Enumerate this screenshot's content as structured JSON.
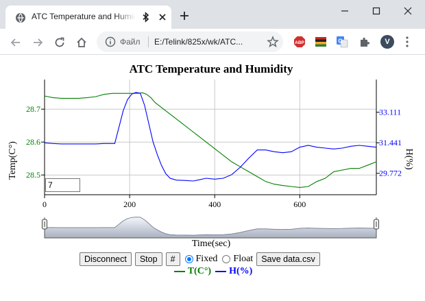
{
  "browser": {
    "tab_title": "ATC Temperature and Humidity",
    "omnibox_label": "Файл",
    "url": "E:/Telink/825x/wk/ATC...",
    "profile_initial": "V"
  },
  "page": {
    "title": "ATC Temperature and Humidity",
    "roll_value": "7",
    "x_axis_label": "Time(sec)",
    "buttons": {
      "disconnect": "Disconnect",
      "stop": "Stop",
      "grid": "#",
      "save": "Save data.csv"
    },
    "radios": {
      "fixed": "Fixed",
      "float": "Float",
      "selected": "Fixed"
    },
    "legend": {
      "temp": "T(C°)",
      "hum": "H(%)"
    }
  },
  "chart_data": {
    "type": "line",
    "title": "ATC Temperature and Humidity",
    "xlabel": "Time(sec)",
    "ylabel": "Temp(C°)",
    "ylabel_right": "H(%)",
    "xlim": [
      0,
      780
    ],
    "x_ticks": [
      "0",
      "200",
      "400",
      "600"
    ],
    "y_left": {
      "lim": [
        28.44,
        28.79
      ],
      "ticks": [
        "28.5",
        "28.6",
        "28.7"
      ]
    },
    "y_right": {
      "lim": [
        28.6,
        34.9
      ],
      "ticks": [
        "29.772",
        "31.441",
        "33.111"
      ]
    },
    "grid": true,
    "legend_position": "bottom-center",
    "series": [
      {
        "name": "T(C°)",
        "color": "#008000",
        "axis": "left",
        "points": [
          [
            0,
            28.74
          ],
          [
            20,
            28.735
          ],
          [
            40,
            28.733
          ],
          [
            60,
            28.733
          ],
          [
            80,
            28.733
          ],
          [
            100,
            28.735
          ],
          [
            120,
            28.738
          ],
          [
            140,
            28.745
          ],
          [
            160,
            28.748
          ],
          [
            180,
            28.748
          ],
          [
            200,
            28.748
          ],
          [
            220,
            28.748
          ],
          [
            230,
            28.75
          ],
          [
            240,
            28.745
          ],
          [
            250,
            28.735
          ],
          [
            260,
            28.72
          ],
          [
            280,
            28.7
          ],
          [
            300,
            28.68
          ],
          [
            320,
            28.66
          ],
          [
            340,
            28.64
          ],
          [
            360,
            28.62
          ],
          [
            380,
            28.6
          ],
          [
            400,
            28.58
          ],
          [
            420,
            28.56
          ],
          [
            440,
            28.54
          ],
          [
            460,
            28.525
          ],
          [
            480,
            28.51
          ],
          [
            500,
            28.495
          ],
          [
            520,
            28.48
          ],
          [
            540,
            28.472
          ],
          [
            560,
            28.468
          ],
          [
            580,
            28.465
          ],
          [
            600,
            28.462
          ],
          [
            620,
            28.465
          ],
          [
            640,
            28.48
          ],
          [
            660,
            28.49
          ],
          [
            680,
            28.51
          ],
          [
            700,
            28.515
          ],
          [
            720,
            28.52
          ],
          [
            740,
            28.52
          ],
          [
            760,
            28.53
          ],
          [
            780,
            28.54
          ]
        ]
      },
      {
        "name": "H(%)",
        "color": "#0000ff",
        "axis": "right",
        "points": [
          [
            0,
            31.44
          ],
          [
            20,
            31.4
          ],
          [
            40,
            31.38
          ],
          [
            60,
            31.38
          ],
          [
            80,
            31.38
          ],
          [
            100,
            31.38
          ],
          [
            120,
            31.38
          ],
          [
            140,
            31.4
          ],
          [
            160,
            31.4
          ],
          [
            165,
            31.4
          ],
          [
            175,
            32.3
          ],
          [
            185,
            33.2
          ],
          [
            195,
            33.8
          ],
          [
            205,
            34.1
          ],
          [
            215,
            34.2
          ],
          [
            225,
            34.15
          ],
          [
            235,
            33.5
          ],
          [
            245,
            32.5
          ],
          [
            255,
            31.5
          ],
          [
            265,
            30.8
          ],
          [
            275,
            30.2
          ],
          [
            285,
            29.75
          ],
          [
            295,
            29.5
          ],
          [
            310,
            29.4
          ],
          [
            330,
            29.38
          ],
          [
            350,
            29.35
          ],
          [
            360,
            29.4
          ],
          [
            380,
            29.5
          ],
          [
            400,
            29.45
          ],
          [
            420,
            29.5
          ],
          [
            440,
            29.7
          ],
          [
            460,
            30.1
          ],
          [
            480,
            30.6
          ],
          [
            500,
            31.05
          ],
          [
            520,
            31.05
          ],
          [
            540,
            30.95
          ],
          [
            560,
            30.9
          ],
          [
            580,
            30.95
          ],
          [
            600,
            31.2
          ],
          [
            620,
            31.3
          ],
          [
            640,
            31.2
          ],
          [
            660,
            31.15
          ],
          [
            680,
            31.1
          ],
          [
            700,
            31.15
          ],
          [
            720,
            31.25
          ],
          [
            740,
            31.3
          ],
          [
            760,
            31.25
          ],
          [
            780,
            31.2
          ]
        ]
      }
    ]
  }
}
